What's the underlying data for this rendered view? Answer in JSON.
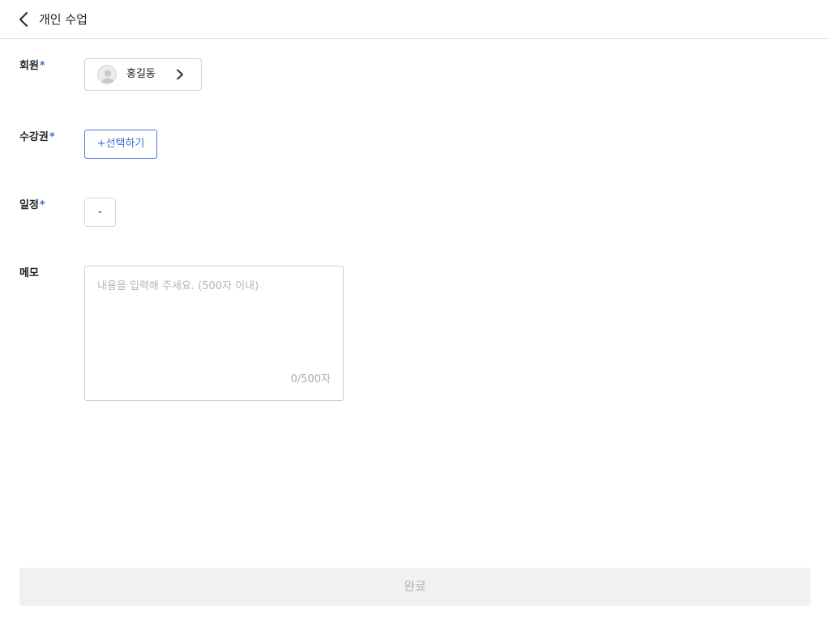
{
  "header": {
    "title": "개인 수업"
  },
  "form": {
    "member": {
      "label": "회원",
      "required_mark": "*",
      "value": "홍길동"
    },
    "ticket": {
      "label": "수강권",
      "required_mark": "*",
      "button_label": "+선택하기"
    },
    "schedule": {
      "label": "일정",
      "required_mark": "*",
      "value": "-"
    },
    "memo": {
      "label": "메모",
      "placeholder": "내용을 입력해 주세요. (500자 이내)",
      "value": "",
      "counter": "0/500자"
    }
  },
  "footer": {
    "done_label": "완료",
    "done_enabled": false
  },
  "icons": {
    "back": "chevron-left-icon",
    "avatar": "user-avatar-icon",
    "member_chevron": "chevron-right-icon"
  },
  "colors": {
    "accent": "#3f6fd4",
    "required": "#3b6fd8",
    "disabled_bg": "#f1f1f1",
    "disabled_text": "#b3b3b3"
  }
}
